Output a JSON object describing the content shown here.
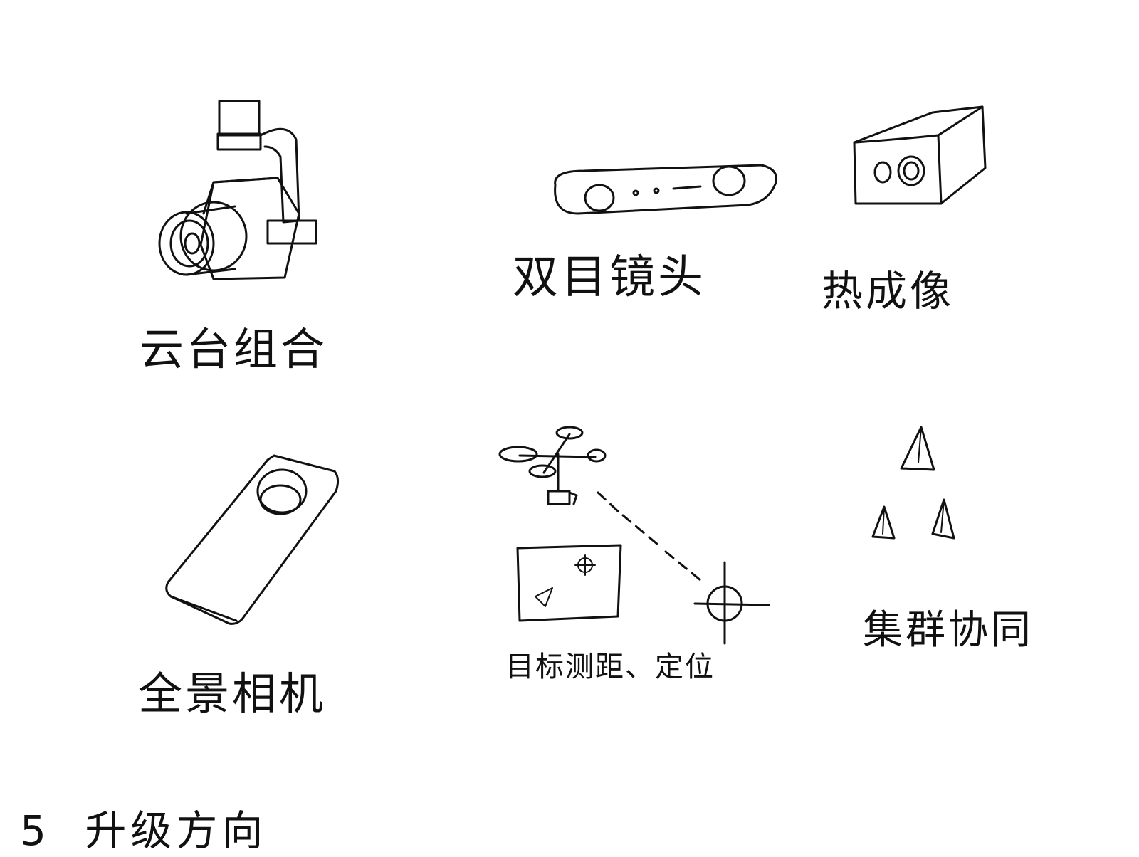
{
  "section": {
    "number": "5",
    "title": "升级方向"
  },
  "items": [
    {
      "id": "gimbal",
      "label": "云台组合",
      "icon": "gimbal-camera-icon"
    },
    {
      "id": "stereo",
      "label": "双目镜头",
      "icon": "stereo-camera-icon"
    },
    {
      "id": "thermal",
      "label": "热成像",
      "icon": "thermal-camera-icon"
    },
    {
      "id": "panorama",
      "label": "全景相机",
      "icon": "panoramic-camera-icon"
    },
    {
      "id": "ranging",
      "label": "目标测距、定位",
      "icon": "drone-targeting-icon"
    },
    {
      "id": "swarm",
      "label": "集群协同",
      "icon": "swarm-formation-icon"
    }
  ]
}
